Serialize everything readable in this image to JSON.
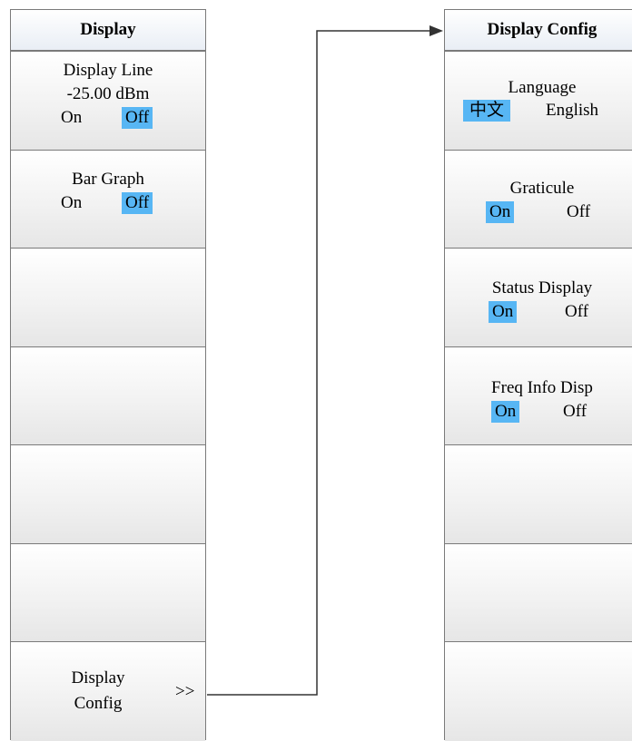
{
  "left_menu": {
    "title": "Display",
    "keys": [
      {
        "title": "Display Line",
        "value": "-25.00 dBm",
        "options": [
          "On",
          "Off"
        ],
        "selected": "Off"
      },
      {
        "title": "Bar Graph",
        "options": [
          "On",
          "Off"
        ],
        "selected": "Off"
      },
      {
        "title": ""
      },
      {
        "title": ""
      },
      {
        "title": ""
      },
      {
        "title": ""
      },
      {
        "title_line1": "Display",
        "title_line2": "Config",
        "submenu_marker": ">>"
      }
    ]
  },
  "right_menu": {
    "title": "Display Config",
    "keys": [
      {
        "title": "Language",
        "options": [
          "中文",
          "English"
        ],
        "selected": "中文"
      },
      {
        "title": "Graticule",
        "options": [
          "On",
          "Off"
        ],
        "selected": "On"
      },
      {
        "title": "Status Display",
        "options": [
          "On",
          "Off"
        ],
        "selected": "On"
      },
      {
        "title": "Freq Info Disp",
        "options": [
          "On",
          "Off"
        ],
        "selected": "On"
      },
      {
        "title": ""
      },
      {
        "title": ""
      },
      {
        "title": ""
      }
    ]
  },
  "colors": {
    "highlight": "#57b6f4",
    "border": "#7a7a7a",
    "connector": "#333333"
  }
}
